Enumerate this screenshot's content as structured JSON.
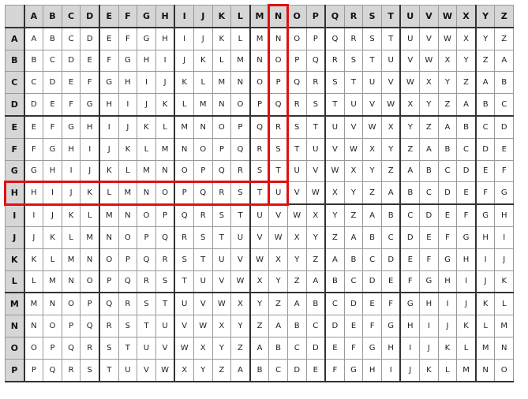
{
  "alphabet": "ABCDEFGHIJKLMNOPQRSTUVWXYZ",
  "visible_rows": 16,
  "highlight": {
    "column": "N",
    "row": "H",
    "color": "#e01010"
  }
}
